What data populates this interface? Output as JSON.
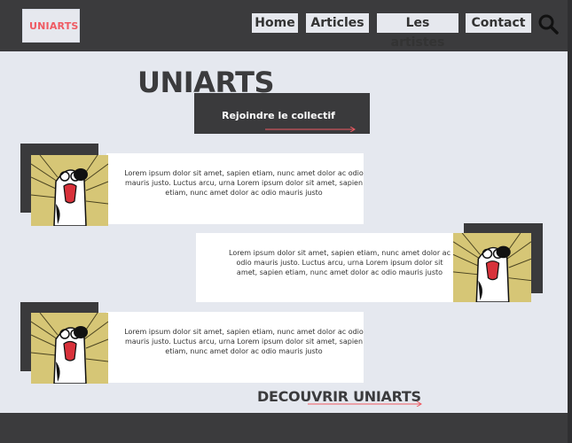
{
  "header": {
    "logo_text": "UNIARTS",
    "nav": [
      "Home",
      "Articles",
      "Les artistes",
      "Contact"
    ]
  },
  "hero": {
    "title": "UNIARTS",
    "join_label": "Rejoindre le collectif"
  },
  "cards": [
    {
      "text": "Lorem ipsum dolor sit amet, sapien etiam, nunc amet dolor ac odio mauris justo. Luctus arcu, urna Lorem ipsum dolor sit amet, sapien etiam, nunc amet dolor ac odio mauris justo"
    },
    {
      "text": "Lorem ipsum dolor sit amet, sapien etiam, nunc amet dolor ac odio mauris justo. Luctus arcu, urna Lorem ipsum dolor sit amet, sapien etiam, nunc amet dolor ac odio mauris justo"
    },
    {
      "text": "Lorem ipsum dolor sit amet, sapien etiam, nunc amet dolor ac odio mauris justo. Luctus arcu, urna Lorem ipsum dolor sit amet, sapien etiam, nunc amet dolor ac odio mauris justo"
    }
  ],
  "discover_label": "DECOUVRIR UNIARTS",
  "colors": {
    "accent": "#ef5a62",
    "dark": "#3a3a3c",
    "light": "#e5e8ef"
  },
  "icons": {
    "search": "search-icon"
  }
}
